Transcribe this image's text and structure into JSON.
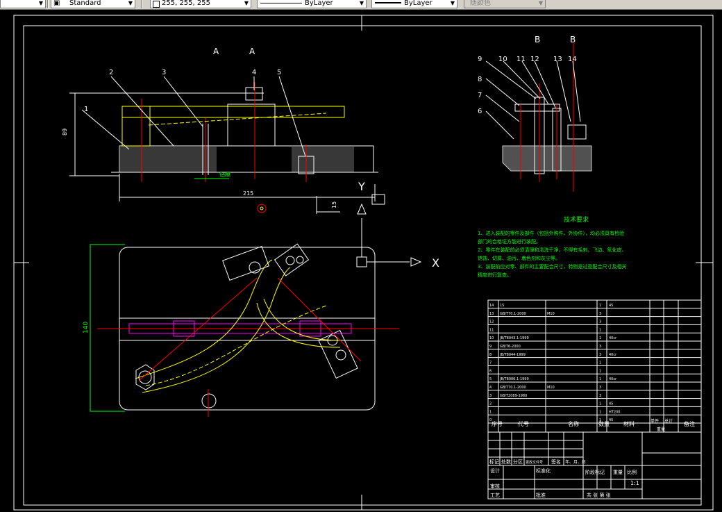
{
  "toolbar": {
    "text_style": "Standard",
    "color_value": "255, 255, 255",
    "linetype": "ByLayer",
    "lineweight": "ByLayer",
    "plot_style": "随颜色"
  },
  "drawing": {
    "section_aa_left": "A",
    "section_aa_right": "A",
    "section_bb_left": "B",
    "section_bb_right": "B",
    "leaders_front": [
      "1",
      "2",
      "3",
      "4",
      "5"
    ],
    "leaders_section": [
      "9",
      "10",
      "11",
      "12",
      "13",
      "14",
      "8",
      "7",
      "6"
    ],
    "dim_height": "89",
    "dim_width": "215",
    "dim_small": "15",
    "dim_vertical": "140",
    "dim_detail": "钻模",
    "axis_x": "X",
    "axis_y": "Y"
  },
  "tech": {
    "title": "技术要求",
    "lines": [
      "1、进入装配的零件及部件（包括外购件、外协件），均必须具有检验",
      "部门的合格证方能进行装配。",
      "2、零件在装配前必须清理和清洗干净，不得有毛刺、飞边、氧化皮、",
      "锈蚀、切屑、油污、着色剂和灰尘等。",
      "3、装配前应对零、部件的主要配合尺寸，特别是过盈配合尺寸及相关",
      "精度进行复查。"
    ]
  },
  "bom": {
    "rows": [
      [
        "14",
        "15",
        "",
        "1",
        "45",
        ""
      ],
      [
        "13",
        "GB/T70.1-2000",
        "M10",
        "3",
        "",
        ""
      ],
      [
        "12",
        "",
        "",
        "3",
        "",
        ""
      ],
      [
        "11",
        "",
        "",
        "1",
        "",
        ""
      ],
      [
        "10",
        "JB/T8043.1-1999",
        "",
        "1",
        "40cr",
        ""
      ],
      [
        "9",
        "GB/T6-2000",
        "",
        "3",
        "",
        ""
      ],
      [
        "8",
        "JB/T8044-1999",
        "",
        "3",
        "40cr",
        ""
      ],
      [
        "7",
        "",
        "",
        "1",
        "",
        ""
      ],
      [
        "6",
        "",
        "",
        "1",
        "",
        ""
      ],
      [
        "5",
        "JB/T8006.1-1999",
        "",
        "1",
        "40cr",
        ""
      ],
      [
        "4",
        "GB/T70.1-2000",
        "M10",
        "3",
        "",
        ""
      ],
      [
        "3",
        "GB/T2089-1980",
        "",
        "3",
        "",
        ""
      ],
      [
        "2",
        "",
        "",
        "1",
        "45",
        ""
      ],
      [
        "1",
        "",
        "",
        "1",
        "HT200",
        ""
      ],
      [
        "0",
        "",
        "",
        "1",
        "45",
        ""
      ]
    ],
    "header": [
      "序号",
      "代号",
      "名称",
      "数量",
      "材料",
      "单件",
      "总计",
      "备注"
    ],
    "header_sub": "重量",
    "tb_labels": [
      "标记",
      "处数",
      "分区",
      "更改文件号",
      "签名",
      "年、月、日"
    ],
    "tb_design": "设计",
    "tb_standard": "标准化",
    "tb_review": "审核",
    "tb_process": "工艺",
    "tb_approve": "批准",
    "stage": "阶段标记",
    "weight": "重量",
    "scale_label": "比例",
    "scale": "1:1",
    "sheets": "共 张 第 张"
  }
}
